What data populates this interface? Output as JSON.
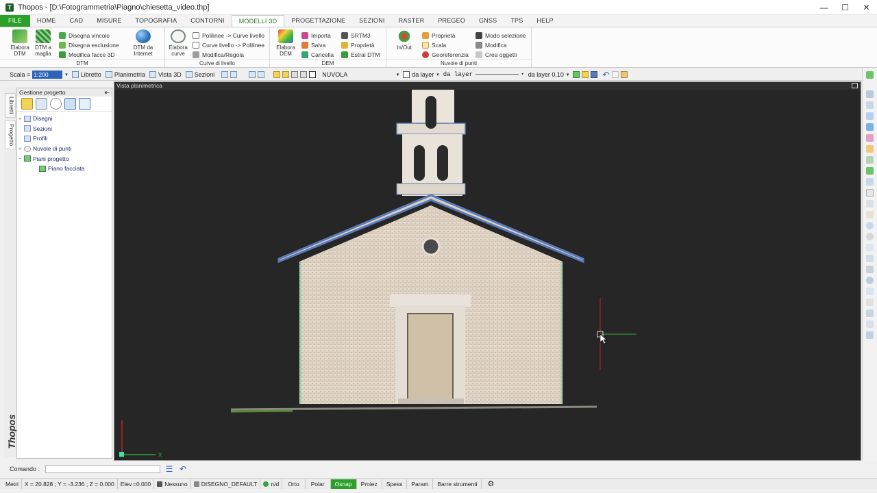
{
  "window": {
    "app_name": "Thopos",
    "title": "Thopos - [D:\\Fotogrammetria\\Piagno\\chiesetta_video.thp]",
    "controls": [
      "—",
      "☐",
      "✕"
    ]
  },
  "menu": {
    "tabs": [
      "FILE",
      "HOME",
      "CAD",
      "MISURE",
      "TOPOGRAFIA",
      "CONTORNI",
      "MODELLI 3D",
      "PROGETTAZIONE",
      "SEZIONI",
      "RASTER",
      "PREGEO",
      "GNSS",
      "TPS",
      "HELP"
    ],
    "active": "MODELLI 3D"
  },
  "ribbon": {
    "dtm": {
      "title": "DTM",
      "elabora_dtm": "Elabora DTM",
      "dtm_a_maglia": "DTM a maglia",
      "disegna_vincolo": "Disegna vincolo",
      "disegna_esclusione": "Disegna esclusione",
      "modifica_facce": "Modifica facce 3D",
      "dtm_da_internet": "DTM da Internet"
    },
    "curve": {
      "title": "Curve di livello",
      "elabora_curve": "Elabora curve",
      "polilinee_curve": "Polilinee -> Curve livello",
      "curve_polilinee": "Curve livello -> Polilinee",
      "modifica_regola": "Modifica/Regola"
    },
    "dem": {
      "title": "DEM",
      "elabora_dem": "Elabora DEM",
      "importa": "Importa",
      "salva": "Salva",
      "cancella": "Cancella",
      "srtm3": "SRTM3",
      "proprieta": "Proprietà",
      "estrai_dtm": "Estrai DTM"
    },
    "nuvole": {
      "title": "Nuvole di punti",
      "in_out": "In/Out",
      "proprieta": "Proprietà",
      "scala": "Scala",
      "georeferenzia": "Georeferenzia",
      "modo_selezione": "Modo selezione",
      "modifica": "Modifica",
      "crea_oggetti": "Crea oggetti"
    }
  },
  "options": {
    "scala_label": "Scala =",
    "scala_value": "1:200",
    "libretto": "Libretto",
    "planimetria": "Planimetria",
    "vista3d": "Vista 3D",
    "sezioni": "Sezioni",
    "layer_name": "NUVOLA",
    "da_layer": "da layer",
    "da_layer_line": "da layer",
    "da_layer_width": "da layer 0.10"
  },
  "side_tabs": [
    "Libretti",
    "Progetto"
  ],
  "brand": "Thopos",
  "panel": {
    "title": "Gestione progetto",
    "tree": [
      {
        "label": "Disegni",
        "level": 0,
        "expand": "+"
      },
      {
        "label": "Sezioni",
        "level": 0,
        "expand": ""
      },
      {
        "label": "Profili",
        "level": 0,
        "expand": ""
      },
      {
        "label": "Nuvole di punti",
        "level": 0,
        "expand": "+"
      },
      {
        "label": "Piani progetto",
        "level": 0,
        "expand": "−"
      },
      {
        "label": "Piano facciata",
        "level": 1,
        "expand": ""
      }
    ]
  },
  "viewport": {
    "title": "Vista planimetrica",
    "axis_x": "X"
  },
  "command": {
    "label": "Comando :"
  },
  "status": {
    "units": "Metri",
    "coords": "X = 20.828 ; Y = -3.236 ; Z = 0.000",
    "elev": "Elev.=0.000",
    "nessuno": "Nessuno",
    "drawing": "DISEGNO_DEFAULT",
    "nd": "n/d",
    "orto": "Orto",
    "polar": "Polar",
    "osnap": "Osnap",
    "proiez": "Proiez",
    "spess": "Spess",
    "param": "Param",
    "barre": "Barre strumenti"
  },
  "colors": {
    "accent_green": "#2ba12b",
    "viewport_bg": "#262626",
    "selection_blue": "#2f63b8"
  }
}
